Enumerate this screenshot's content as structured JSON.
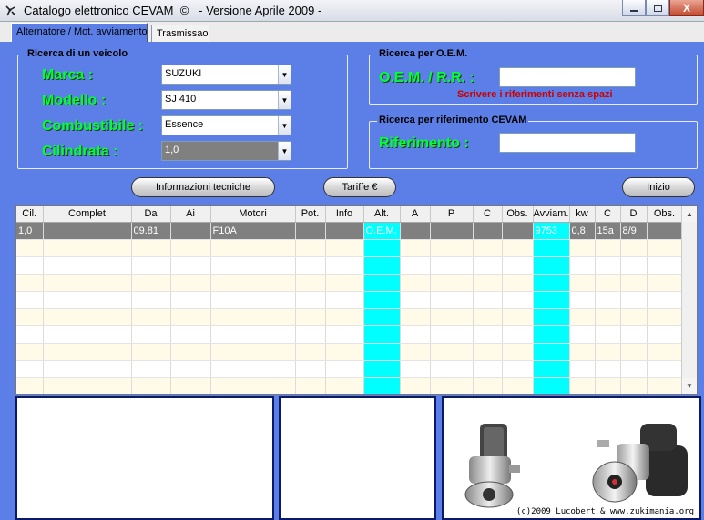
{
  "window": {
    "title": "Catalogo elettronico CEVAM  ©   - Versione Aprile 2009 -",
    "minimize_icon": "minimize-icon",
    "maximize_icon": "maximize-icon",
    "close_label": "X"
  },
  "tabs": [
    {
      "label": "Alternatore / Mot. avviamento",
      "active": true
    },
    {
      "label": "Trasmissao",
      "active": false
    }
  ],
  "vehicle_search": {
    "group_title": "Ricerca di un veicolo",
    "marca_label": "Marca :",
    "marca_value": "SUZUKI",
    "modello_label": "Modello :",
    "modello_value": "SJ 410",
    "combustibile_label": "Combustibile :",
    "combustibile_value": "Essence",
    "cilindrata_label": "Cilindrata :",
    "cilindrata_value": "1,0"
  },
  "oem_search": {
    "group_title": "Ricerca per O.E.M.",
    "label": "O.E.M. / R.R. :",
    "value": "",
    "note": "Scrivere i riferimenti senza spazi"
  },
  "cevam_search": {
    "group_title": "Ricerca per riferimento CEVAM",
    "label": "Riferimento :",
    "value": ""
  },
  "buttons": {
    "info_tecniche": "Informazioni tecniche",
    "tariffe": "Tariffe €",
    "inizio": "Inizio"
  },
  "table": {
    "columns": [
      "Cil.",
      "Complet",
      "Da",
      "Ai",
      "Motori",
      "Pot.",
      "Info",
      "Alt.",
      "A",
      "P",
      "C",
      "Obs.",
      "Avviam.",
      "kw",
      "C",
      "D",
      "Obs."
    ],
    "rows": [
      [
        "1,0",
        "",
        "09.81",
        "",
        "F10A",
        "",
        "",
        "O.E.M.",
        "",
        "",
        "",
        "",
        "9753",
        "0,8",
        "15a",
        "8/9",
        ""
      ]
    ],
    "empty_rows": 9,
    "highlight_color": "#00ffff"
  },
  "images": {
    "starter_small": "starter-motor-photo",
    "starter_large": "starter-motor-photo"
  },
  "copyright": "(c)2009 Lucobert & www.zukimania.org"
}
